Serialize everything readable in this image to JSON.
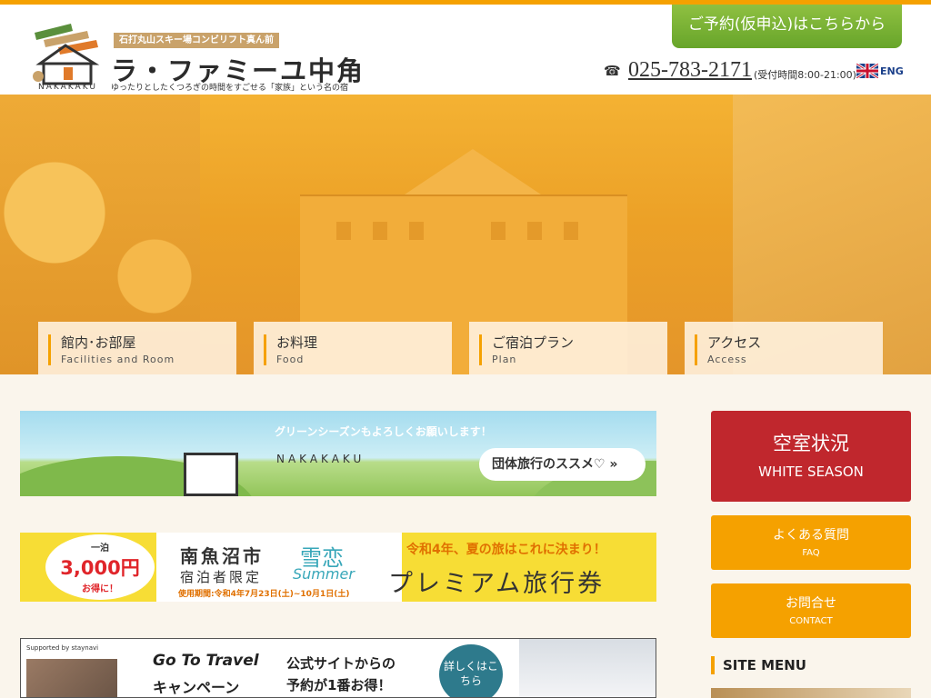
{
  "header": {
    "tagline": "石打丸山スキー場コンビリフト真ん前",
    "site_name": "ラ・ファミーユ中角",
    "site_sub": "ゆったりとしたくつろぎの時間をすごせる「家族」という名の宿",
    "logo_text": "NAKAKAKU",
    "reserve_button": "ご予約(仮申込)はこちらから",
    "phone": "025-783-2171",
    "phone_hours": "(受付時間8:00-21:00)",
    "lang_link": "ENG"
  },
  "nav": [
    {
      "jp": "館内･お部屋",
      "en": "Facilities and Room"
    },
    {
      "jp": "お料理",
      "en": "Food"
    },
    {
      "jp": "ご宿泊プラン",
      "en": "Plan"
    },
    {
      "jp": "アクセス",
      "en": "Access"
    }
  ],
  "banner1": {
    "message": "グリーンシーズンもよろしくお願いします！",
    "brand": "NAKAKAKU",
    "button": "団体旅行のススメ♡ »"
  },
  "banner2": {
    "price_top": "一泊",
    "price": "3,000円",
    "price_bottom": "お得に！",
    "city": "南魚沼市",
    "limit": "宿泊者限定",
    "yukikoi": "雪恋",
    "summer": "Summer",
    "period": "使用期間:令和4年7月23日(土)~10月1日(土)",
    "headline": "令和4年、夏の旅はこれに決まり！",
    "title": "プレミアム旅行券"
  },
  "banner3": {
    "supported": "Supported by staynavi",
    "goto": "Go To Travel",
    "campaign": "キャンペーン",
    "msg1": "公式サイトからの",
    "msg2": "予約が1番お得！",
    "badge": "詳しくはこちら"
  },
  "sidebar": {
    "vacancy_jp": "空室状況",
    "vacancy_en": "WHITE SEASON",
    "faq_jp": "よくある質問",
    "faq_en": "FAQ",
    "contact_jp": "お問合せ",
    "contact_en": "CONTACT",
    "site_menu": "SITE MENU"
  },
  "colors": {
    "accent": "#f5a100",
    "reserve_green": "#7bb334",
    "vacancy_red": "#c0272d"
  }
}
